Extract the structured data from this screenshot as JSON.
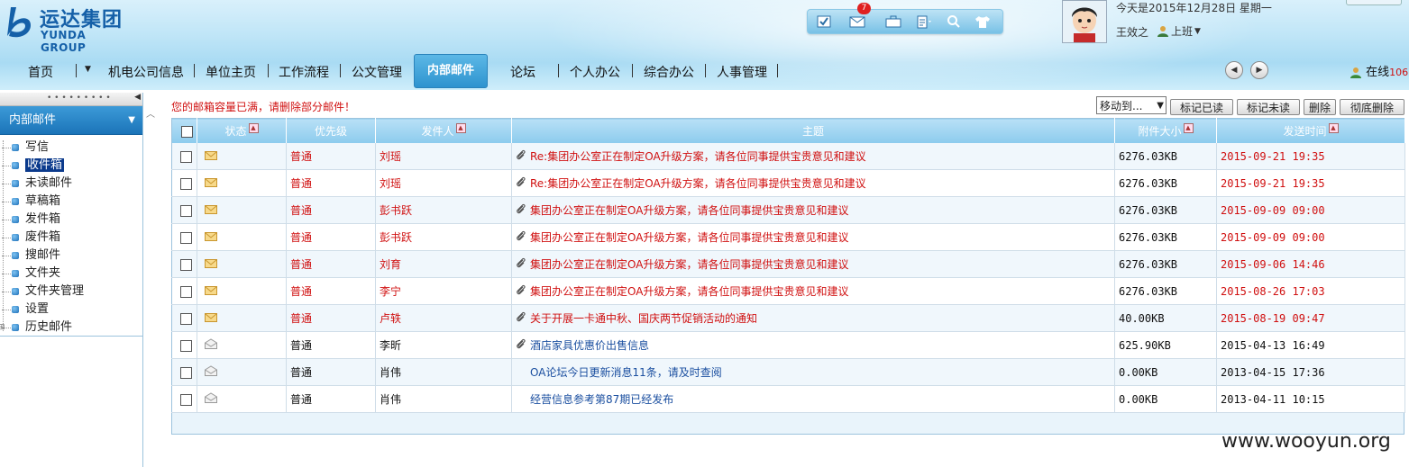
{
  "brand": {
    "name_cn": "运达集团",
    "name_en": "YUNDA GROUP"
  },
  "toolbar": {
    "icons": [
      "check-icon",
      "mail-icon",
      "briefcase-icon",
      "document-icon",
      "search-icon",
      "shirt-icon"
    ],
    "mail_badge": "7"
  },
  "user": {
    "date_line": "今天是2015年12月28日 星期一",
    "name": "王效之",
    "status": "上班"
  },
  "nav": {
    "items": [
      "首页",
      "机电公司信息",
      "单位主页",
      "工作流程",
      "公文管理",
      "内部邮件",
      "论坛",
      "个人办公",
      "综合办公",
      "人事管理"
    ],
    "active": "内部邮件",
    "online_label": "在线",
    "online_count": "106"
  },
  "sidebar": {
    "title": "内部邮件",
    "items": [
      "写信",
      "收件箱",
      "未读邮件",
      "草稿箱",
      "发件箱",
      "废件箱",
      "搜邮件",
      "文件夹",
      "文件夹管理",
      "设置",
      "历史邮件"
    ],
    "selected": "收件箱"
  },
  "main": {
    "warning": "您的邮箱容量已满，请删除部分邮件！",
    "move_select": "移动到...",
    "buttons": [
      "标记已读",
      "标记未读",
      "删除",
      "彻底删除"
    ],
    "columns": [
      "状态",
      "优先级",
      "发件人",
      "主题",
      "附件大小",
      "发送时间"
    ]
  },
  "emails": [
    {
      "unread": true,
      "priority": "普通",
      "sender": "刘瑶",
      "attach": true,
      "subject": "Re:集团办公室正在制定OA升级方案，请各位同事提供宝贵意见和建议",
      "size": "6276.03KB",
      "time": "2015-09-21 19:35"
    },
    {
      "unread": true,
      "priority": "普通",
      "sender": "刘瑶",
      "attach": true,
      "subject": "Re:集团办公室正在制定OA升级方案，请各位同事提供宝贵意见和建议",
      "size": "6276.03KB",
      "time": "2015-09-21 19:35"
    },
    {
      "unread": true,
      "priority": "普通",
      "sender": "彭书跃",
      "attach": true,
      "subject": "集团办公室正在制定OA升级方案，请各位同事提供宝贵意见和建议",
      "size": "6276.03KB",
      "time": "2015-09-09 09:00"
    },
    {
      "unread": true,
      "priority": "普通",
      "sender": "彭书跃",
      "attach": true,
      "subject": "集团办公室正在制定OA升级方案，请各位同事提供宝贵意见和建议",
      "size": "6276.03KB",
      "time": "2015-09-09 09:00"
    },
    {
      "unread": true,
      "priority": "普通",
      "sender": "刘育",
      "attach": true,
      "subject": "集团办公室正在制定OA升级方案，请各位同事提供宝贵意见和建议",
      "size": "6276.03KB",
      "time": "2015-09-06 14:46"
    },
    {
      "unread": true,
      "priority": "普通",
      "sender": "李宁",
      "attach": true,
      "subject": "集团办公室正在制定OA升级方案，请各位同事提供宝贵意见和建议",
      "size": "6276.03KB",
      "time": "2015-08-26 17:03"
    },
    {
      "unread": true,
      "priority": "普通",
      "sender": "卢轶",
      "attach": true,
      "subject": "关于开展一卡通中秋、国庆两节促销活动的通知",
      "size": "40.00KB",
      "time": "2015-08-19 09:47"
    },
    {
      "unread": false,
      "priority": "普通",
      "sender": "李昕",
      "attach": true,
      "subject": "酒店家具优惠价出售信息",
      "size": "625.90KB",
      "time": "2015-04-13 16:49"
    },
    {
      "unread": false,
      "priority": "普通",
      "sender": "肖伟",
      "attach": false,
      "subject": "OA论坛今日更新消息11条，请及时查阅",
      "size": "0.00KB",
      "time": "2013-04-15 17:36"
    },
    {
      "unread": false,
      "priority": "普通",
      "sender": "肖伟",
      "attach": false,
      "subject": "经营信息参考第87期已经发布",
      "size": "0.00KB",
      "time": "2013-04-11 10:15"
    }
  ],
  "watermark": "www.wooyun.org",
  "colors": {
    "unread": "#d01010",
    "read_subject": "#1b4fa0",
    "header_bg": "#bfe5f7",
    "accent": "#2e93cf"
  }
}
